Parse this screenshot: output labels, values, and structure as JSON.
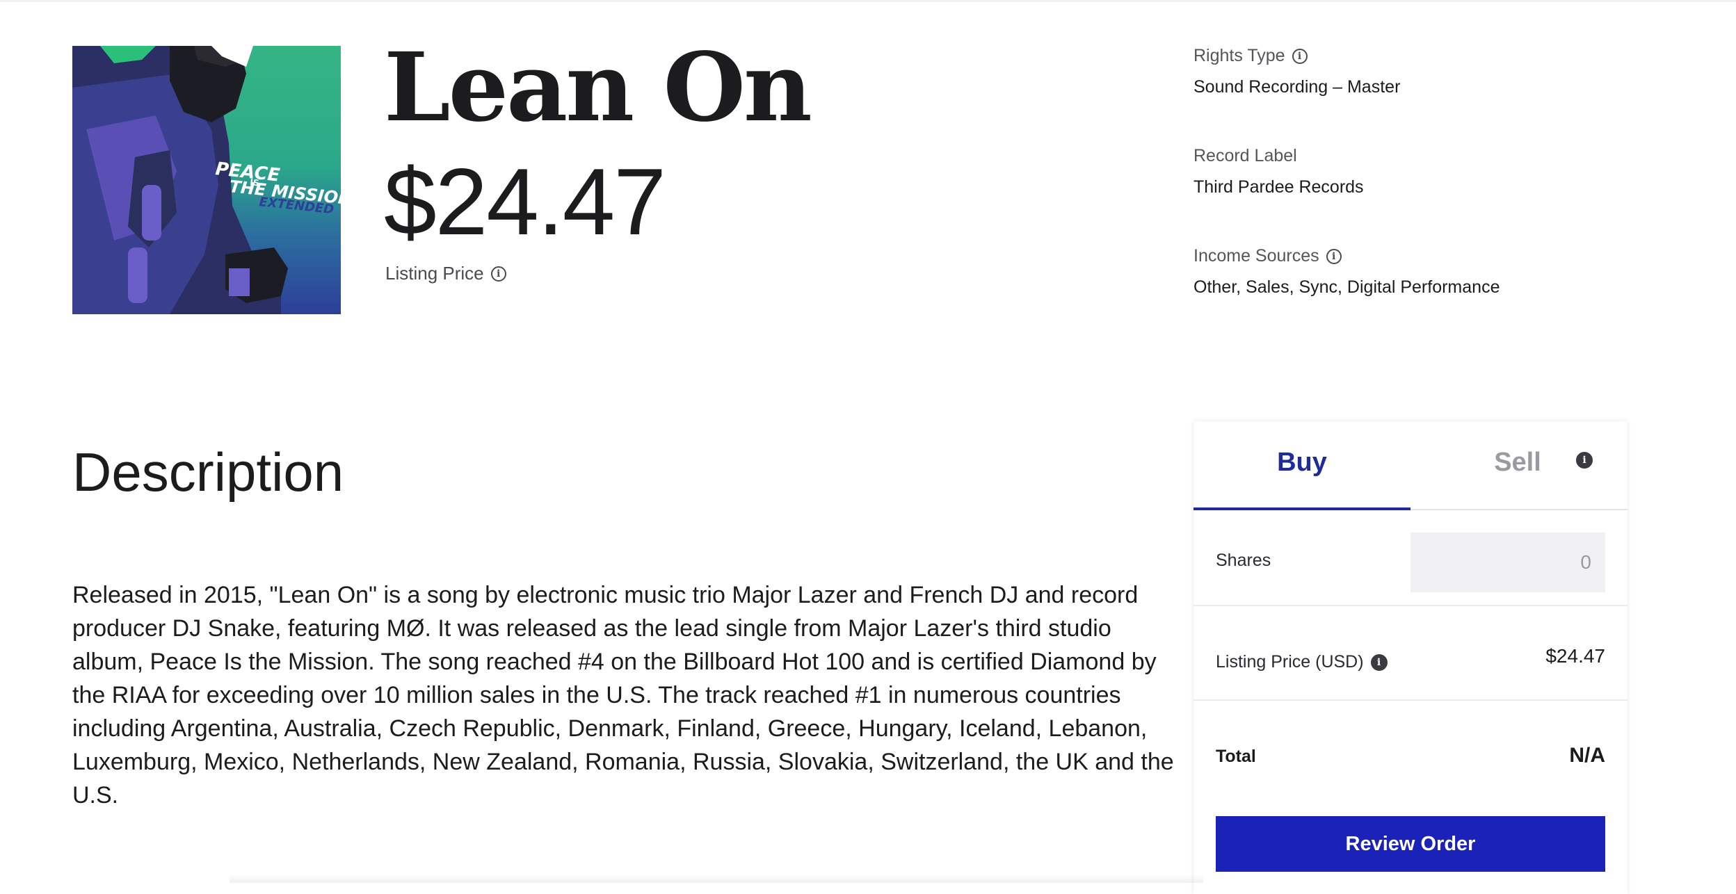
{
  "track": {
    "title": "Lean On",
    "listing_price": "$24.47",
    "listing_price_label": "Listing Price",
    "cover": {
      "art_text_line1": "PEACE IS THE MISSION",
      "art_text_line2": "EXTENDED"
    }
  },
  "meta": {
    "rights_type_label": "Rights Type",
    "rights_type_value": "Sound Recording – Master",
    "record_label_label": "Record Label",
    "record_label_value": "Third Pardee Records",
    "income_sources_label": "Income Sources",
    "income_sources_value": "Other, Sales, Sync, Digital Performance"
  },
  "description": {
    "heading": "Description",
    "body": "Released in 2015, \"Lean On\" is a song by electronic music trio Major Lazer and French DJ and record producer DJ Snake, featuring MØ. It was released  as the lead single from Major Lazer's third studio album, Peace Is the Mission. The song reached #4 on the Billboard Hot 100 and is certified Diamond by the RIAA for exceeding over 10 million sales in the U.S. The track reached #1 in numerous countries including Argentina, Australia, Czech Republic, Denmark, Finland, Greece, Hungary, Iceland, Lebanon, Luxemburg, Mexico, Netherlands, New Zealand, Romania, Russia, Slovakia, Switzerland, the UK and the U.S."
  },
  "order_panel": {
    "tab_buy": "Buy",
    "tab_sell": "Sell",
    "active_tab": "Buy",
    "shares_label": "Shares",
    "shares_placeholder": "0",
    "listing_price_label": "Listing Price (USD)",
    "listing_price_value": "$24.47",
    "total_label": "Total",
    "total_value": "N/A",
    "review_button": "Review Order"
  },
  "colors": {
    "accent": "#1f2a9c",
    "button": "#1b22b8",
    "muted_text": "#9a9aa0"
  },
  "icons": [
    "info-icon",
    "info-filled-icon"
  ]
}
